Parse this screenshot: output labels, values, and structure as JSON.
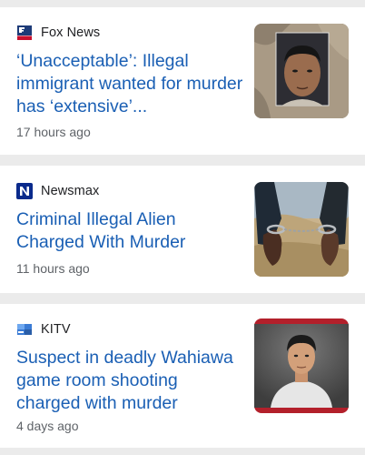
{
  "articles": [
    {
      "source": "Fox News",
      "source_icon": "fox-news-logo-icon",
      "headline": "‘Unacceptable’: Illegal immigrant wanted for murder has ‘extensive’...",
      "time": "17 hours ago",
      "thumbnail": "mugshot-thumbnail"
    },
    {
      "source": "Newsmax",
      "source_icon": "newsmax-logo-icon",
      "headline": "Criminal Illegal Alien Charged With Murder",
      "time": "11 hours ago",
      "thumbnail": "handcuffed-hands-thumbnail"
    },
    {
      "source": "KITV",
      "source_icon": "kitv-logo-icon",
      "headline": "Suspect in deadly Wahiawa game room shooting charged with murder",
      "time": "4 days ago",
      "thumbnail": "suspect-portrait-thumbnail"
    }
  ],
  "colors": {
    "headline": "#1a5fb4",
    "source_text": "#202124",
    "time_text": "#5f6368",
    "card_bg": "#ffffff",
    "divider_bg": "#ebebeb"
  }
}
